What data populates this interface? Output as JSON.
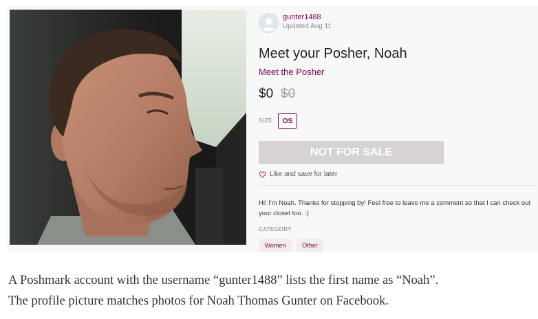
{
  "profile": {
    "username": "gunter1488",
    "updated": "Updated Aug 11"
  },
  "listing": {
    "title": "Meet your Posher, Noah",
    "subtitle": "Meet the Posher",
    "price": "$0",
    "original_price": "$0",
    "size_label": "SIZE",
    "size_value": "OS",
    "status_button": "NOT FOR SALE",
    "like_text": "Like and save for later",
    "description": "Hi! I'm Noah. Thanks for stopping by! Feel free to leave me a comment so that I can check out your closet too. :)",
    "category_label": "CATEGORY",
    "categories": [
      "Women",
      "Other"
    ]
  },
  "caption": {
    "line1": "A Poshmark account with the username “gunter1488” lists the first name as “Noah”.",
    "line2": "The profile picture matches photos for Noah Thomas Gunter on Facebook."
  },
  "colors": {
    "accent": "#7f0353",
    "button_disabled": "#d8d3d3",
    "panel_bg": "#f9f8f8"
  },
  "icons": {
    "avatar": "avatar-placeholder-icon",
    "like": "heart-outline-icon"
  }
}
